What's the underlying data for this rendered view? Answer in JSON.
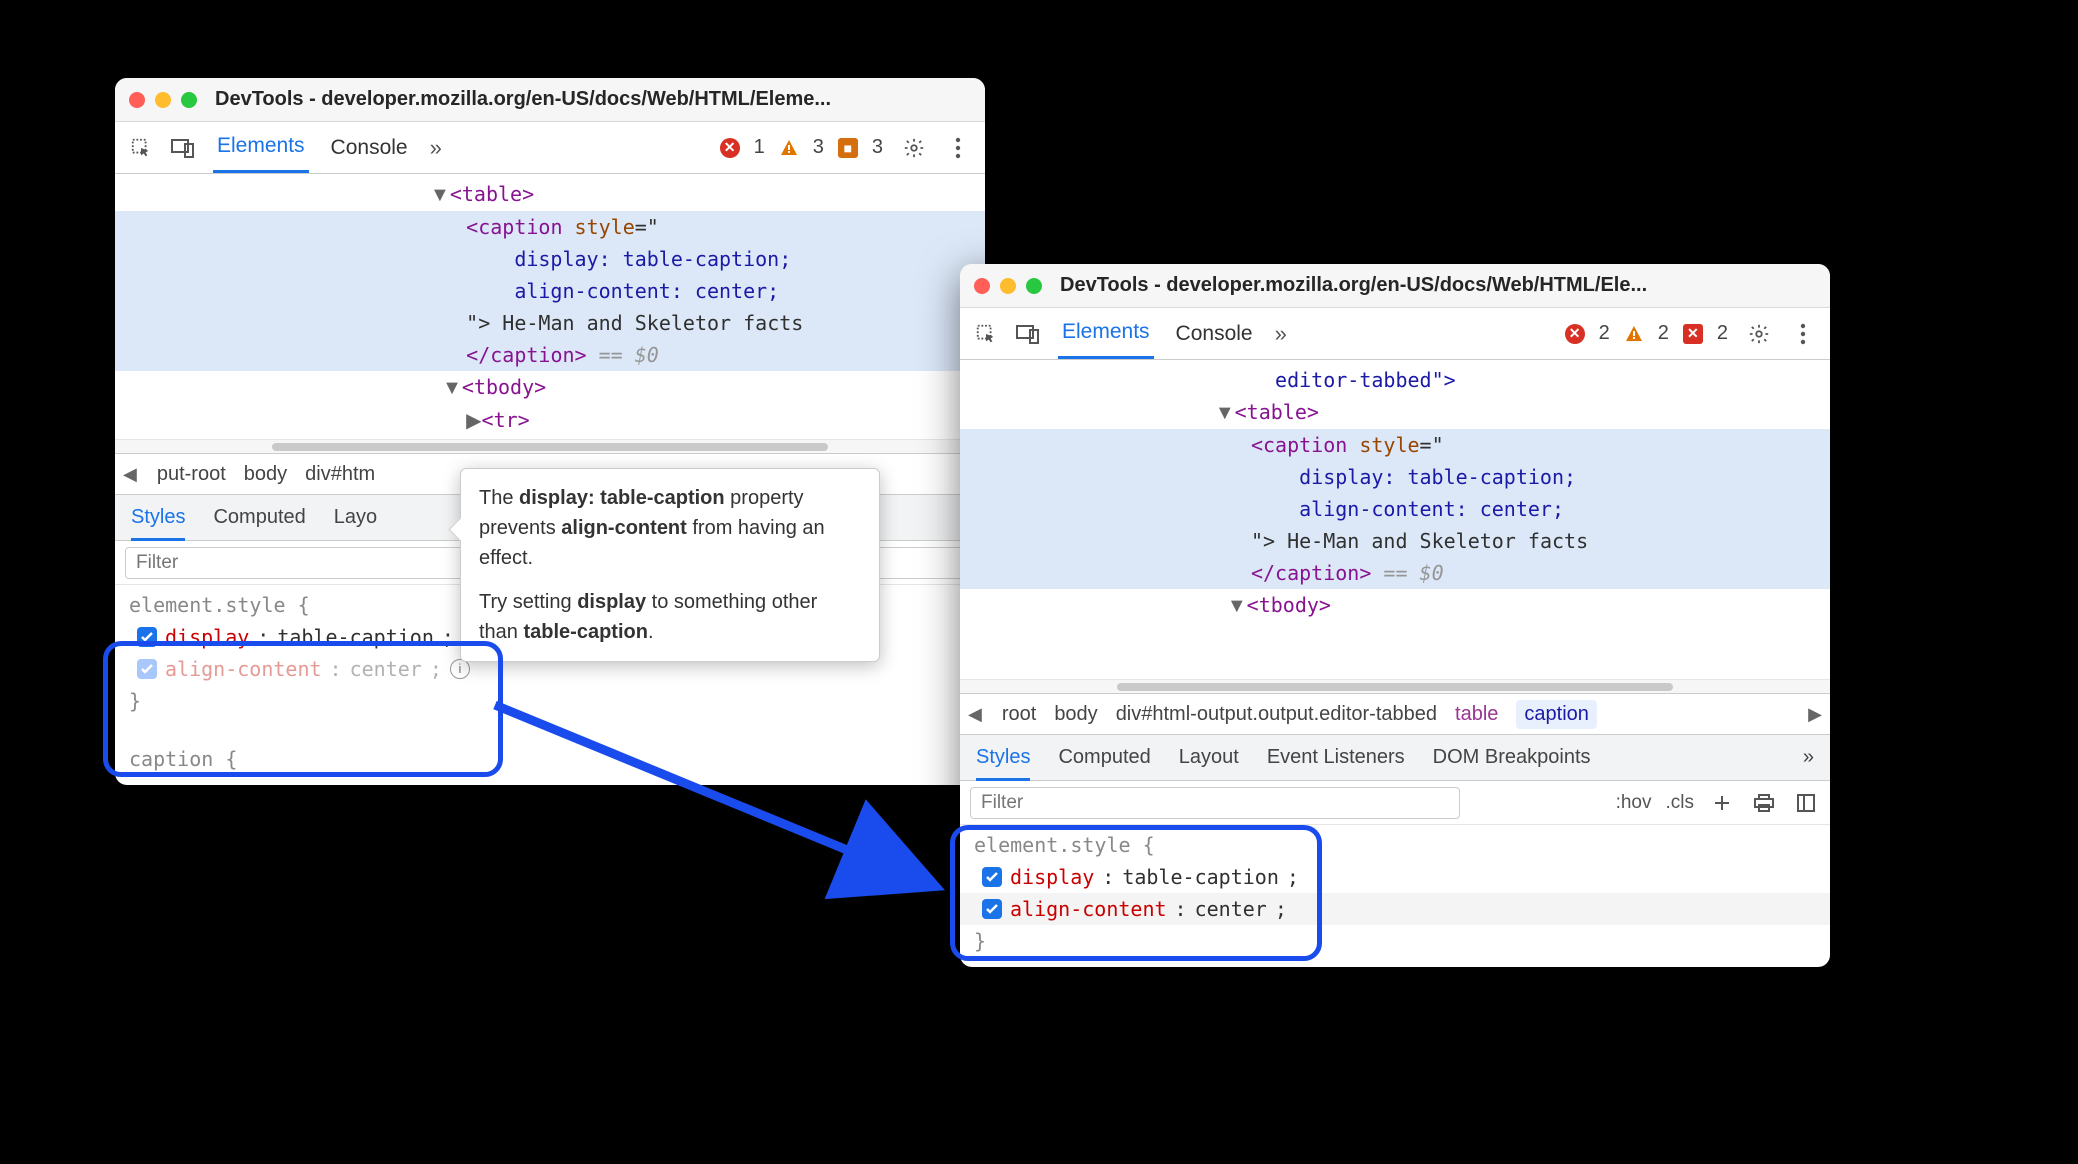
{
  "left": {
    "title": "DevTools - developer.mozilla.org/en-US/docs/Web/HTML/Eleme...",
    "tabs": {
      "elements": "Elements",
      "console": "Console"
    },
    "counts": {
      "errors": "1",
      "warnings": "3",
      "flags": "3"
    },
    "dom": {
      "l0_tag": "<table>",
      "l1_open": "<caption",
      "l1_attr": "style",
      "l1_eq": "=\"",
      "l2": "display: table-caption;",
      "l3": "align-content: center;",
      "l4_q": "\">",
      "l4_text": " He-Man and Skeletor facts",
      "l5_close": "</caption>",
      "l5_hint": " == $0",
      "l6_tag": "<tbody>",
      "l7_tag": "<tr>"
    },
    "crumbs": {
      "c0": "put-root",
      "c1": "body",
      "c2": "div#htm"
    },
    "ptabs": {
      "styles": "Styles",
      "computed": "Computed",
      "layout": "Layo"
    },
    "filter_ph": "Filter",
    "rule": {
      "head": "element.style {",
      "p1_name": "display",
      "p1_val": "table-caption",
      "p2_name": "align-content",
      "p2_val": "center",
      "end": "}"
    },
    "tooltip": {
      "s1a": "The ",
      "s1b": "display: table-caption",
      "s1c": " property prevents ",
      "s1d": "align-content",
      "s1e": " from having an effect.",
      "s2a": "Try setting ",
      "s2b": "display",
      "s2c": " to something other than ",
      "s2d": "table-caption",
      "s2e": "."
    },
    "tail": "caption {"
  },
  "right": {
    "title": "DevTools - developer.mozilla.org/en-US/docs/Web/HTML/Ele...",
    "tabs": {
      "elements": "Elements",
      "console": "Console"
    },
    "counts": {
      "errors": "2",
      "warnings": "2",
      "flags": "2"
    },
    "dom": {
      "l0": "editor-tabbed\">",
      "l1_tag": "<table>",
      "l2_open": "<caption",
      "l2_attr": "style",
      "l2_eq": "=\"",
      "l3": "display: table-caption;",
      "l4": "align-content: center;",
      "l5_q": "\">",
      "l5_text": " He-Man and Skeletor facts",
      "l6_close": "</caption>",
      "l6_hint": " == $0",
      "l7_tag": "<tbody>"
    },
    "crumbs": {
      "c0": "root",
      "c1": "body",
      "c2": "div#html-output.output.editor-tabbed",
      "c3": "table",
      "c4": "caption"
    },
    "ptabs": {
      "styles": "Styles",
      "computed": "Computed",
      "layout": "Layout",
      "events": "Event Listeners",
      "dom_bp": "DOM Breakpoints"
    },
    "filter_ph": "Filter",
    "hov": ":hov",
    "cls": ".cls",
    "rule": {
      "head": "element.style {",
      "p1_name": "display",
      "p1_val": "table-caption",
      "p2_name": "align-content",
      "p2_val": "center",
      "end": "}"
    }
  }
}
